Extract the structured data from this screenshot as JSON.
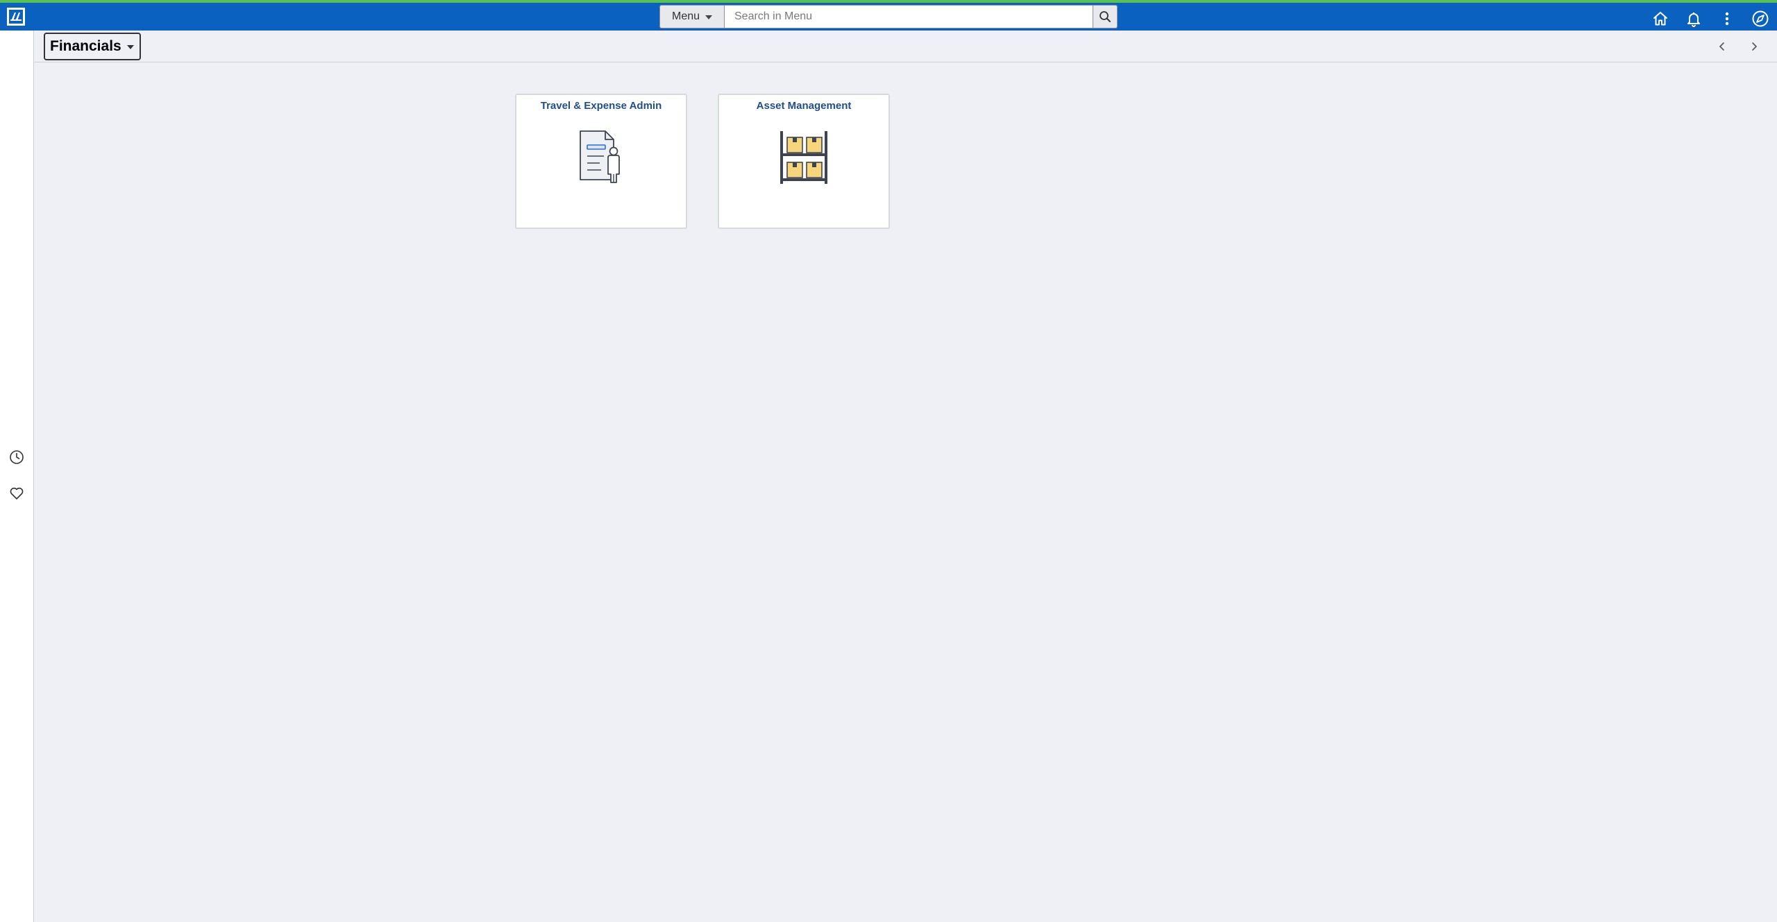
{
  "topbar": {
    "menu_label": "Menu",
    "search_placeholder": "Search in Menu",
    "colors": {
      "banner": "#0b61c0",
      "accent_stripe": "#57c252"
    },
    "icons": [
      "home-icon",
      "notifications-icon",
      "actions-menu-icon",
      "navbar-icon"
    ]
  },
  "left_rail": {
    "icons": [
      "recent-items-icon",
      "favorites-icon"
    ]
  },
  "page_header": {
    "homepage_title": "Financials",
    "nav_icons": [
      "previous-icon",
      "next-icon"
    ]
  },
  "tiles": [
    {
      "title": "Travel & Expense Admin",
      "icon": "document-person-icon"
    },
    {
      "title": "Asset Management",
      "icon": "storage-shelf-icon"
    }
  ]
}
